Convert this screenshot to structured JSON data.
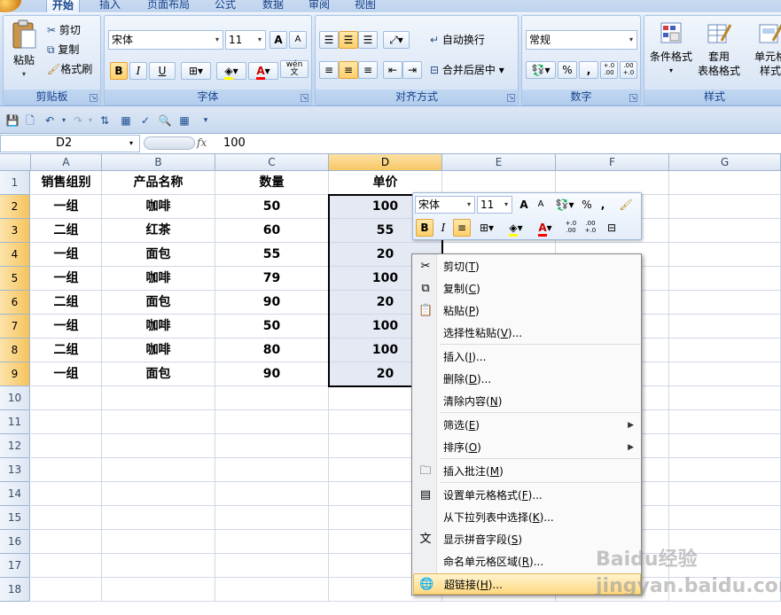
{
  "ribbon_tabs": [
    "开始",
    "插入",
    "页面布局",
    "公式",
    "数据",
    "审阅",
    "视图"
  ],
  "clipboard": {
    "paste": "粘贴",
    "cut": "剪切",
    "copy": "复制",
    "format_painter": "格式刷",
    "label": "剪贴板"
  },
  "font": {
    "name": "宋体",
    "size": "11",
    "label": "字体",
    "bold": "B",
    "italic": "I",
    "underline": "U",
    "grow": "A",
    "shrink": "A",
    "font_color": "A",
    "phonetic": "wén 文"
  },
  "alignment": {
    "wrap": "自动换行",
    "merge": "合并后居中",
    "label": "对齐方式"
  },
  "number": {
    "format": "常规",
    "percent": "%",
    "comma": ",",
    "inc_dec": "+.0 .00",
    "dec_dec": ".00 +.0",
    "label": "数字"
  },
  "styles": {
    "cond": "条件格式",
    "table_1": "套用",
    "table_2": "表格格式",
    "cell_1": "单元格",
    "cell_2": "样式",
    "label": "样式"
  },
  "formula_bar": {
    "name_box": "D2",
    "fx": "fx",
    "value": "100"
  },
  "columns": [
    "A",
    "B",
    "C",
    "D",
    "E",
    "F",
    "G"
  ],
  "rows": [
    "1",
    "2",
    "3",
    "4",
    "5",
    "6",
    "7",
    "8",
    "9",
    "10",
    "11",
    "12",
    "13",
    "14",
    "15",
    "16",
    "17",
    "18"
  ],
  "table": {
    "headers": [
      "销售组别",
      "产品名称",
      "数量",
      "单价"
    ],
    "rows": [
      [
        "一组",
        "咖啡",
        "50",
        "100"
      ],
      [
        "二组",
        "红茶",
        "60",
        "55"
      ],
      [
        "一组",
        "面包",
        "55",
        "20"
      ],
      [
        "一组",
        "咖啡",
        "79",
        "100"
      ],
      [
        "二组",
        "面包",
        "90",
        "20"
      ],
      [
        "一组",
        "咖啡",
        "50",
        "100"
      ],
      [
        "二组",
        "咖啡",
        "80",
        "100"
      ],
      [
        "一组",
        "面包",
        "90",
        "20"
      ]
    ]
  },
  "mini_toolbar": {
    "font": "宋体",
    "size": "11",
    "percent": "%",
    "comma": ","
  },
  "context_menu": [
    {
      "icon": "scissors-icon",
      "text": "剪切",
      "key": "T"
    },
    {
      "icon": "copy-icon",
      "text": "复制",
      "key": "C"
    },
    {
      "icon": "paste-icon",
      "text": "粘贴",
      "key": "P"
    },
    {
      "icon": "",
      "text": "选择性粘贴",
      "key": "V",
      "suffix": "..."
    },
    {
      "icon": "",
      "text": "插入",
      "key": "I",
      "suffix": "..."
    },
    {
      "icon": "",
      "text": "删除",
      "key": "D",
      "suffix": "..."
    },
    {
      "icon": "",
      "text": "清除内容",
      "key": "N"
    },
    {
      "icon": "",
      "text": "筛选",
      "key": "E",
      "submenu": true
    },
    {
      "icon": "",
      "text": "排序",
      "key": "O",
      "submenu": true
    },
    {
      "icon": "comment-icon",
      "text": "插入批注",
      "key": "M"
    },
    {
      "icon": "format-cells-icon",
      "text": "设置单元格格式",
      "key": "F",
      "suffix": "..."
    },
    {
      "icon": "",
      "text": "从下拉列表中选择",
      "key": "K",
      "suffix": "..."
    },
    {
      "icon": "phonetic-icon",
      "text": "显示拼音字段",
      "key": "S"
    },
    {
      "icon": "",
      "text": "命名单元格区域",
      "key": "R",
      "suffix": "..."
    },
    {
      "icon": "hyperlink-icon",
      "text": "超链接",
      "key": "H",
      "suffix": "..."
    }
  ],
  "watermark": "Baidu经验 jingyan.baidu.com",
  "colors": {
    "accent": "#15428b",
    "selection_header": "#f8c765",
    "hover": "#ffd980"
  }
}
